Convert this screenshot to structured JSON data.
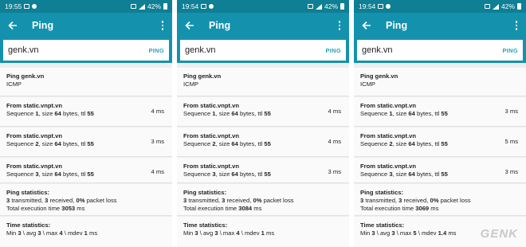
{
  "screens": [
    {
      "time": "19:55",
      "battery": "42%",
      "title": "Ping",
      "host": "genk.vn",
      "ping_button": "PING",
      "header": {
        "title": "Ping genk.vn",
        "protocol": "ICMP"
      },
      "replies": [
        {
          "from": "From static.vnpt.vn",
          "seq_label": "Sequence",
          "seq": "1",
          "size_label": ", size",
          "size": "64",
          "bytes_label": "bytes, ttl",
          "ttl": "55",
          "ms": "4 ms"
        },
        {
          "from": "From static.vnpt.vn",
          "seq_label": "Sequence",
          "seq": "2",
          "size_label": ", size",
          "size": "64",
          "bytes_label": "bytes, ttl",
          "ttl": "55",
          "ms": "3 ms"
        },
        {
          "from": "From static.vnpt.vn",
          "seq_label": "Sequence",
          "seq": "3",
          "size_label": ", size",
          "size": "64",
          "bytes_label": "bytes, ttl",
          "ttl": "55",
          "ms": "4 ms"
        }
      ],
      "stats": {
        "title": "Ping statistics:",
        "transmitted": "3",
        "transmitted_label": "transmitted,",
        "received": "3",
        "received_label": "received,",
        "loss": "0%",
        "loss_label": "packet loss",
        "exec_label": "Total execution time",
        "exec": "3053",
        "exec_unit": "ms"
      },
      "time_stats": {
        "title": "Time statistics:",
        "min_label": "Min",
        "min": "3",
        "avg_label": "\\ avg",
        "avg": "3",
        "max_label": "\\ max",
        "max": "4",
        "mdev_label": "\\ mdev",
        "mdev": "1",
        "unit": "ms"
      }
    },
    {
      "time": "19:54",
      "battery": "42%",
      "title": "Ping",
      "host": "genk.vn",
      "ping_button": "PING",
      "header": {
        "title": "Ping genk.vn",
        "protocol": "ICMP"
      },
      "replies": [
        {
          "from": "From static.vnpt.vn",
          "seq_label": "Sequence",
          "seq": "1",
          "size_label": ", size",
          "size": "64",
          "bytes_label": "bytes, ttl",
          "ttl": "55",
          "ms": "4 ms"
        },
        {
          "from": "From static.vnpt.vn",
          "seq_label": "Sequence",
          "seq": "2",
          "size_label": ", size",
          "size": "64",
          "bytes_label": "bytes, ttl",
          "ttl": "55",
          "ms": "4 ms"
        },
        {
          "from": "From static.vnpt.vn",
          "seq_label": "Sequence",
          "seq": "3",
          "size_label": ", size",
          "size": "64",
          "bytes_label": "bytes, ttl",
          "ttl": "55",
          "ms": "3 ms"
        }
      ],
      "stats": {
        "title": "Ping statistics:",
        "transmitted": "3",
        "transmitted_label": "transmitted,",
        "received": "3",
        "received_label": "received,",
        "loss": "0%",
        "loss_label": "packet loss",
        "exec_label": "Total execution time",
        "exec": "3084",
        "exec_unit": "ms"
      },
      "time_stats": {
        "title": "Time statistics:",
        "min_label": "Min",
        "min": "3",
        "avg_label": "\\ avg",
        "avg": "3",
        "max_label": "\\ max",
        "max": "4",
        "mdev_label": "\\ mdev",
        "mdev": "1",
        "unit": "ms"
      }
    },
    {
      "time": "19:54",
      "battery": "42%",
      "title": "Ping",
      "host": "genk.vn",
      "ping_button": "PING",
      "header": {
        "title": "Ping genk.vn",
        "protocol": "ICMP"
      },
      "replies": [
        {
          "from": "From static.vnpt.vn",
          "seq_label": "Sequence",
          "seq": "1",
          "size_label": ", size",
          "size": "64",
          "bytes_label": "bytes, ttl",
          "ttl": "55",
          "ms": "3 ms"
        },
        {
          "from": "From static.vnpt.vn",
          "seq_label": "Sequence",
          "seq": "2",
          "size_label": ", size",
          "size": "64",
          "bytes_label": "bytes, ttl",
          "ttl": "55",
          "ms": "5 ms"
        },
        {
          "from": "From static.vnpt.vn",
          "seq_label": "Sequence",
          "seq": "3",
          "size_label": ", size",
          "size": "64",
          "bytes_label": "bytes, ttl",
          "ttl": "55",
          "ms": "3 ms"
        }
      ],
      "stats": {
        "title": "Ping statistics:",
        "transmitted": "3",
        "transmitted_label": "transmitted,",
        "received": "3",
        "received_label": "received,",
        "loss": "0%",
        "loss_label": "packet loss",
        "exec_label": "Total execution time",
        "exec": "3069",
        "exec_unit": "ms"
      },
      "time_stats": {
        "title": "Time statistics:",
        "min_label": "Min",
        "min": "3",
        "avg_label": "\\ avg",
        "avg": "3",
        "max_label": "\\ max",
        "max": "5",
        "mdev_label": "\\ mdev",
        "mdev": "1.4",
        "unit": "ms"
      }
    }
  ],
  "watermark": "GENK",
  "colors": {
    "appbar": "#1492ad",
    "statusbar": "#0e7f94",
    "ping_button": "#27a3b8",
    "card_bg": "#fafafa",
    "page_bg": "#eeeeee"
  },
  "icons": {
    "back": "arrow-left-icon",
    "menu": "more-vert-icon"
  }
}
